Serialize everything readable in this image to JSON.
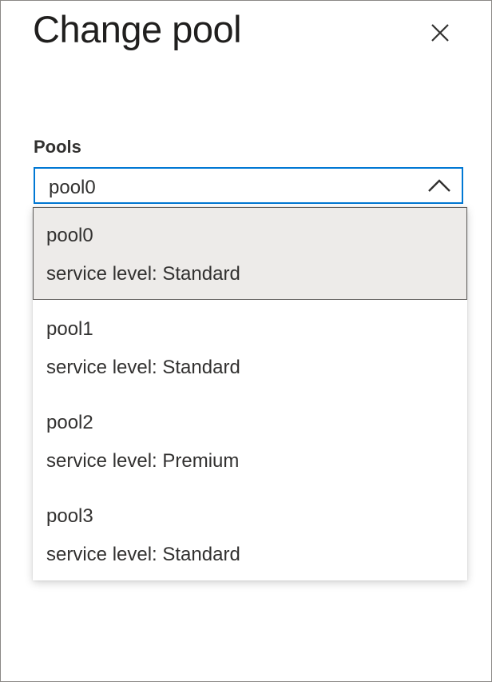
{
  "panel": {
    "title": "Change pool",
    "close_icon": "close-icon"
  },
  "pools": {
    "label": "Pools",
    "selected_value": "pool0",
    "chevron_icon": "chevron-up-icon",
    "options": [
      {
        "name": "pool0",
        "service_level": "service level: Standard",
        "selected": true
      },
      {
        "name": "pool1",
        "service_level": "service level: Standard",
        "selected": false
      },
      {
        "name": "pool2",
        "service_level": "service level: Premium",
        "selected": false
      },
      {
        "name": "pool3",
        "service_level": "service level: Standard",
        "selected": false
      }
    ]
  },
  "colors": {
    "accent": "#0078d4",
    "selected_bg": "#edebe9",
    "text": "#323130"
  }
}
